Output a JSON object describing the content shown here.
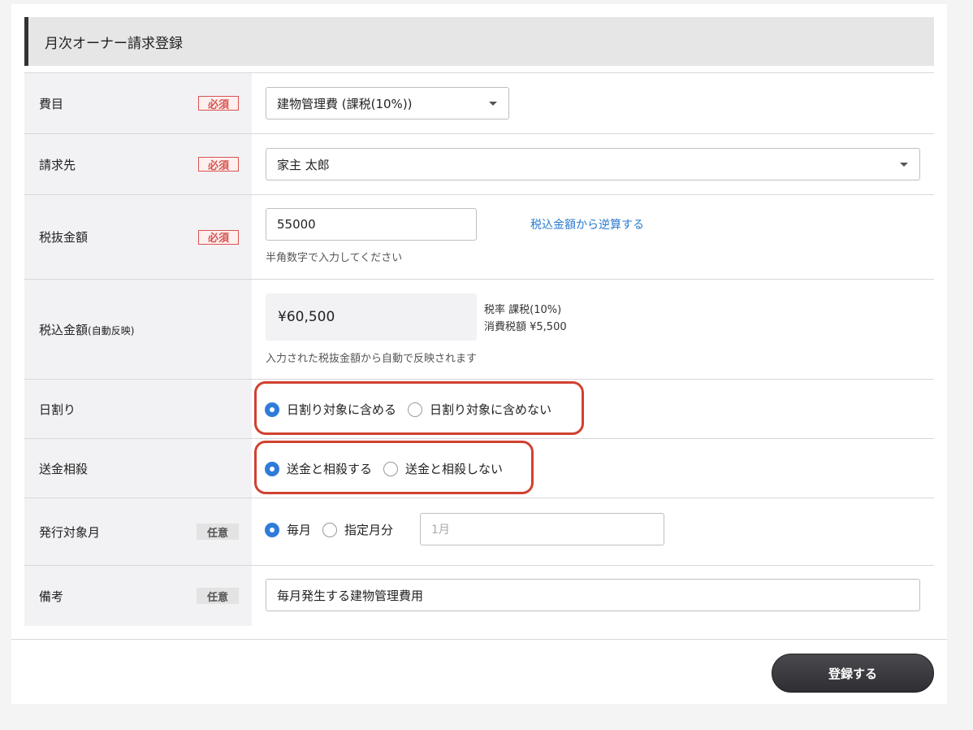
{
  "header": {
    "title": "月次オーナー請求登録"
  },
  "badges": {
    "required": "必須",
    "optional": "任意"
  },
  "rows": {
    "expense": {
      "label": "費目",
      "value": "建物管理費 (課税(10%))"
    },
    "billing_to": {
      "label": "請求先",
      "value": "家主 太郎"
    },
    "amount_excl": {
      "label": "税抜金額",
      "value": "55000",
      "hint": "半角数字で入力してください",
      "link": "税込金額から逆算する"
    },
    "amount_incl": {
      "label": "税込金額",
      "label_sub": "(自動反映)",
      "value": "¥60,500",
      "tax_rate": "税率 課税(10%)",
      "tax_amount": "消費税額 ¥5,500",
      "hint": "入力された税抜金額から自動で反映されます"
    },
    "prorate": {
      "label": "日割り",
      "options": [
        "日割り対象に含める",
        "日割り対象に含めない"
      ],
      "selected": 0
    },
    "offset": {
      "label": "送金相殺",
      "options": [
        "送金と相殺する",
        "送金と相殺しない"
      ],
      "selected": 0
    },
    "issue_month": {
      "label": "発行対象月",
      "options": [
        "毎月",
        "指定月分"
      ],
      "selected": 0,
      "month_placeholder": "1月"
    },
    "note": {
      "label": "備考",
      "value": "毎月発生する建物管理費用"
    }
  },
  "footer": {
    "submit_label": "登録する"
  },
  "colors": {
    "accent": "#2f7bd9",
    "required": "#d9534f",
    "highlight": "#d0412f"
  }
}
